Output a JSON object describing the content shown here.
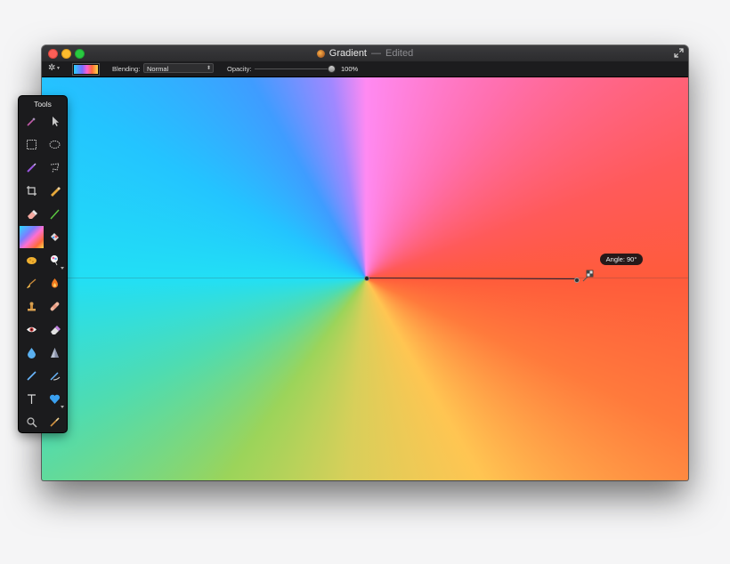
{
  "window": {
    "title": "Gradient",
    "separator": "—",
    "status": "Edited"
  },
  "toolbar": {
    "blending_label": "Blending:",
    "blending_value": "Normal",
    "opacity_label": "Opacity:",
    "opacity_value": "100%",
    "opacity_level": 1.0
  },
  "canvas": {
    "angle_tooltip": "Angle: 90°"
  },
  "tools_panel": {
    "title": "Tools",
    "tools": [
      {
        "name": "magic-wand-icon"
      },
      {
        "name": "arrow-pointer-icon"
      },
      {
        "name": "rect-select-icon"
      },
      {
        "name": "ellipse-select-icon"
      },
      {
        "name": "pen-select-icon"
      },
      {
        "name": "lasso-icon"
      },
      {
        "name": "crop-icon"
      },
      {
        "name": "pencil-icon"
      },
      {
        "name": "eraser-icon"
      },
      {
        "name": "brush-line-icon"
      },
      {
        "name": "gradient-icon"
      },
      {
        "name": "paint-bucket-icon"
      },
      {
        "name": "sponge-icon"
      },
      {
        "name": "paint-balloon-icon"
      },
      {
        "name": "smudge-brush-icon"
      },
      {
        "name": "flame-burn-icon"
      },
      {
        "name": "stamp-icon"
      },
      {
        "name": "bandage-heal-icon"
      },
      {
        "name": "red-eye-icon"
      },
      {
        "name": "clone-eraser-icon"
      },
      {
        "name": "water-drop-icon"
      },
      {
        "name": "sharpen-cone-icon"
      },
      {
        "name": "line-draw-icon"
      },
      {
        "name": "bezier-pen-icon"
      },
      {
        "name": "text-tool-icon"
      },
      {
        "name": "heart-shape-icon"
      },
      {
        "name": "zoom-icon"
      },
      {
        "name": "color-picker-icon"
      }
    ]
  },
  "colors": {
    "window_bg": "#1e1e20",
    "close": "#fc5f57",
    "minimize": "#fdbc2e",
    "zoom": "#29c940"
  }
}
